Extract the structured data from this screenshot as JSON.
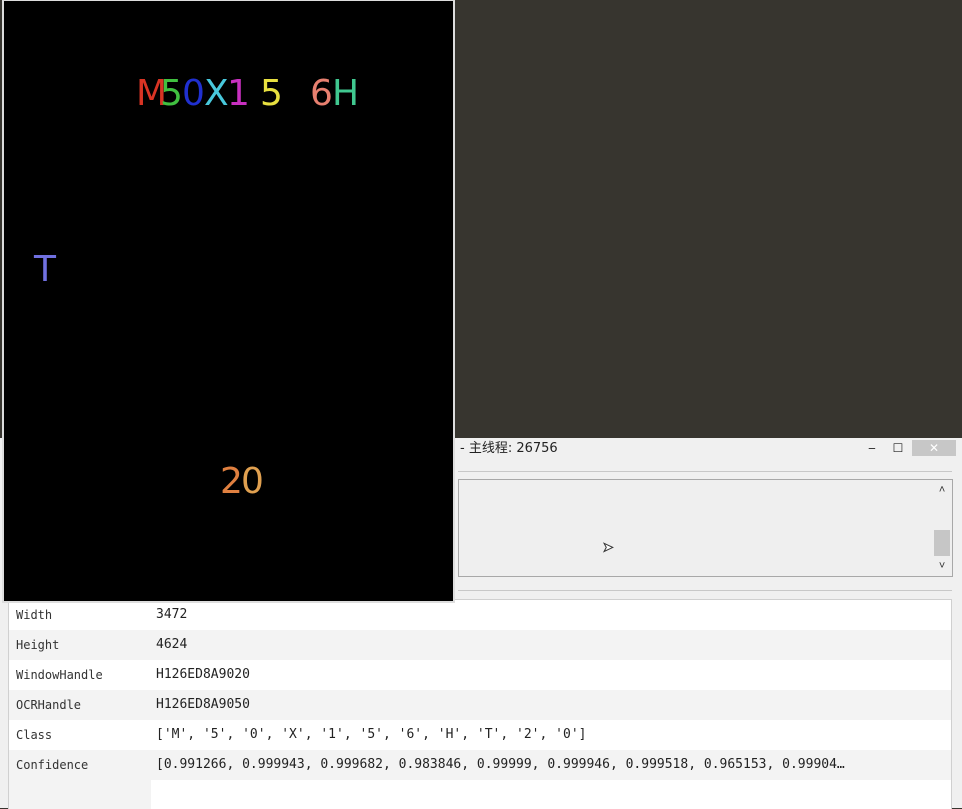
{
  "window": {
    "title": "- 主线程: 26756",
    "minimize_label": "‒",
    "maximize_label": "☐",
    "close_label": "✕"
  },
  "image_view": {
    "chars": [
      {
        "text": "M",
        "color": "#d83424"
      },
      {
        "text": "5",
        "color": "#40c040"
      },
      {
        "text": "0",
        "color": "#2030d0"
      },
      {
        "text": "X",
        "color": "#48c8dc"
      },
      {
        "text": "1",
        "color": "#c830c0"
      },
      {
        "text": "5",
        "color": "#e8e040"
      },
      {
        "text": "6",
        "color": "#e88070"
      },
      {
        "text": "H",
        "color": "#40c890"
      },
      {
        "text": "T",
        "color": "#7070e0"
      },
      {
        "text": "2",
        "color": "#e08040"
      },
      {
        "text": "0",
        "color": "#e0a050"
      }
    ]
  },
  "table": {
    "rows": [
      {
        "key": "Width",
        "value": "3472"
      },
      {
        "key": "Height",
        "value": "4624"
      },
      {
        "key": "WindowHandle",
        "value": "H126ED8A9020"
      },
      {
        "key": "OCRHandle",
        "value": "H126ED8A9050"
      },
      {
        "key": "Class",
        "value": "['M', '5', '0', 'X', '1', '5', '6', 'H', 'T', '2', '0']"
      },
      {
        "key": "Confidence",
        "value": "[0.991266, 0.999943, 0.999682, 0.983846, 0.99999, 0.999946, 0.999518, 0.965153, 0.99904…"
      }
    ]
  },
  "scrollbar": {
    "up": "˄",
    "down": "˅"
  }
}
